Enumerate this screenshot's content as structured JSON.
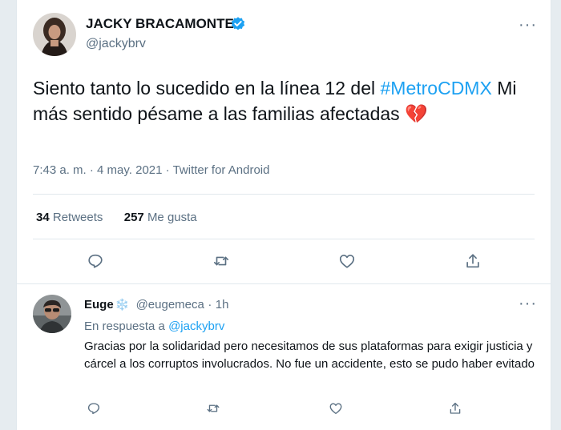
{
  "tweet": {
    "author_name": "JACKY BRACAMONTES",
    "handle": "@jackybrv",
    "text_before_hashtag": "Siento tanto lo sucedido en la línea 12 del",
    "hashtag": "#MetroCDMX",
    "text_after_hashtag": " Mi más sentido pésame a las familias afectadas ",
    "emoji": "💔",
    "time": "7:43 a. m.",
    "separator": "·",
    "date": "4 may. 2021",
    "source": "Twitter for Android",
    "retweets_count": "34",
    "retweets_label": "Retweets",
    "likes_count": "257",
    "likes_label": "Me gusta",
    "more_label": "···"
  },
  "reply": {
    "author_name": "Euge",
    "name_emoji": "❄️",
    "handle": "@eugemeca",
    "separator": "·",
    "time_ago": "1h",
    "replying_to_label": "En respuesta a",
    "replying_to_handle": "@jackybrv",
    "text": "Gracias por la solidaridad pero necesitamos de sus plataformas para exigir justicia y cárcel a los corruptos involucrados. No fue un accidente, esto se pudo haber evitado",
    "more_label": "···"
  },
  "colors": {
    "accent": "#1da1f2",
    "verified": "#1da1f2",
    "muted": "#5b7083",
    "divider": "#e1e8ed"
  },
  "icons": [
    "verified-badge-icon",
    "reply-icon",
    "retweet-icon",
    "like-icon",
    "share-icon",
    "more-icon"
  ]
}
